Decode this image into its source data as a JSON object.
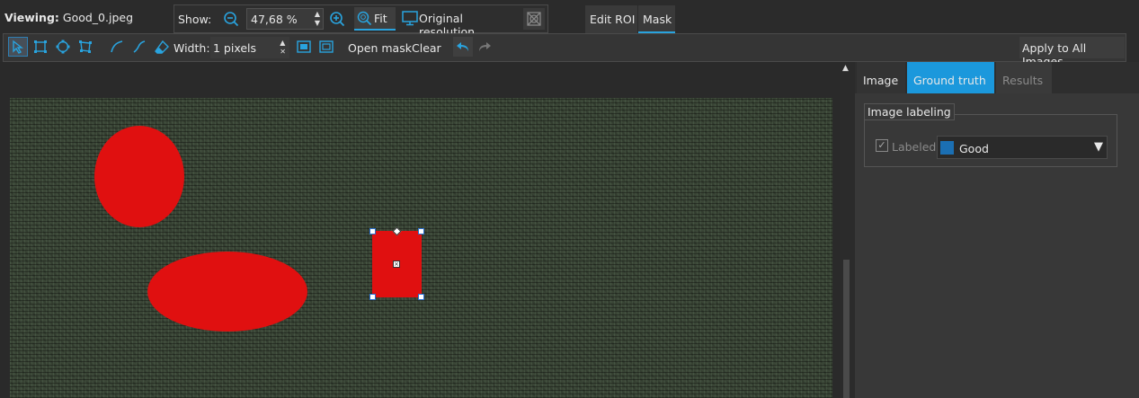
{
  "header": {
    "viewing_label": "Viewing:",
    "filename": "Good_0.jpeg",
    "show_label": "Show:",
    "zoom_value": "47,68 %",
    "fit_label": "Fit",
    "original_label": "Original resolution",
    "tabs": [
      {
        "label": "Edit ROI",
        "active": false
      },
      {
        "label": "Mask",
        "active": true
      }
    ]
  },
  "toolbar": {
    "width_label": "Width:",
    "width_value": "1 pixels",
    "open_mask_label": "Open mask",
    "clear_label": "Clear",
    "apply_label": "Apply to All Images",
    "tools": [
      "select-icon",
      "rectangle-icon",
      "ellipse-icon",
      "polygon-icon",
      "line-icon",
      "curve-icon",
      "eraser-icon",
      "fill-rect-icon",
      "outline-rect-icon",
      "undo-icon",
      "redo-icon"
    ]
  },
  "canvas": {
    "mask_color": "#e01010",
    "image_bg": "#3a4536"
  },
  "panel": {
    "tabs": [
      {
        "label": "Image",
        "active": false
      },
      {
        "label": "Ground truth",
        "active": true
      },
      {
        "label": "Results",
        "active": false
      }
    ],
    "group_title": "Image labeling",
    "labeled_label": "Labeled:",
    "labeled_checked": true,
    "label_value": "Good",
    "label_color": "#1b6fb3",
    "accent": "#1b98dc"
  }
}
